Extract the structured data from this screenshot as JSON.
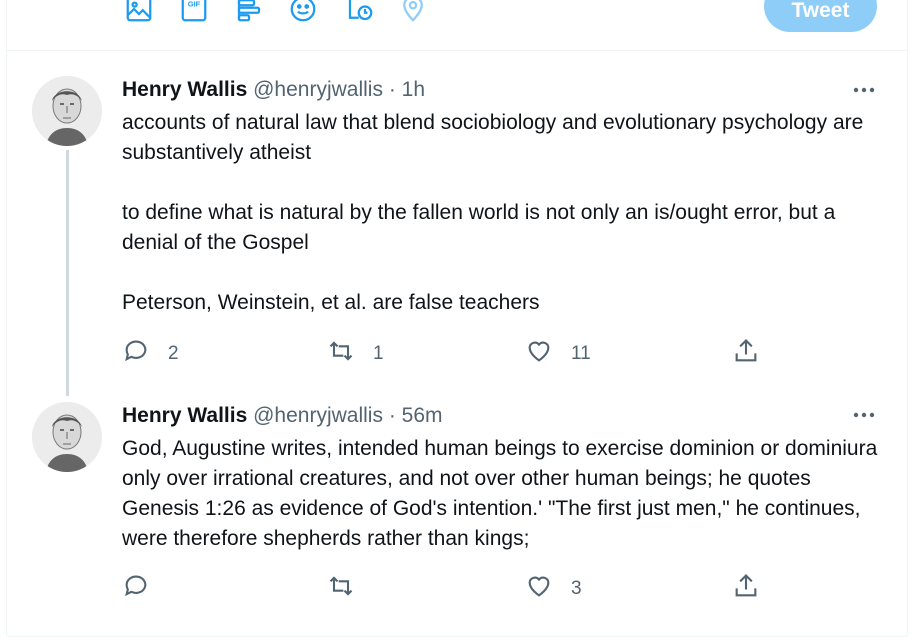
{
  "composer": {
    "icons": [
      "image-icon",
      "gif-icon",
      "poll-icon",
      "emoji-icon",
      "schedule-icon",
      "location-icon"
    ],
    "tweet_label": "Tweet",
    "tweet_color": "#8ecdf7"
  },
  "tweets": [
    {
      "name": "Henry Wallis",
      "handle": "@henryjwallis",
      "separator": "·",
      "time": "1h",
      "paragraphs": [
        "accounts of natural law that blend sociobiology and evolutionary psychology are substantively atheist",
        "to define what is natural by the fallen world is not only an is/ought error, but a denial of the Gospel",
        "Peterson, Weinstein, et al. are false teachers"
      ],
      "replies": "2",
      "retweets": "1",
      "likes": "11"
    },
    {
      "name": "Henry Wallis",
      "handle": "@henryjwallis",
      "separator": "·",
      "time": "56m",
      "paragraphs": [
        "God, Augustine writes, intended human beings to exercise dominion or dominiura only over irrational creatures, and not over other human beings; he quotes Genesis 1:26 as evidence of God's intention.' \"The first just men,\" he continues, were therefore shepherds rather than kings;"
      ],
      "replies": "",
      "retweets": "",
      "likes": "3"
    }
  ],
  "colors": {
    "secondary_text": "#536471",
    "thread_line": "#cfd9de",
    "divider": "#eff3f4",
    "accent": "#1d9bf0"
  }
}
